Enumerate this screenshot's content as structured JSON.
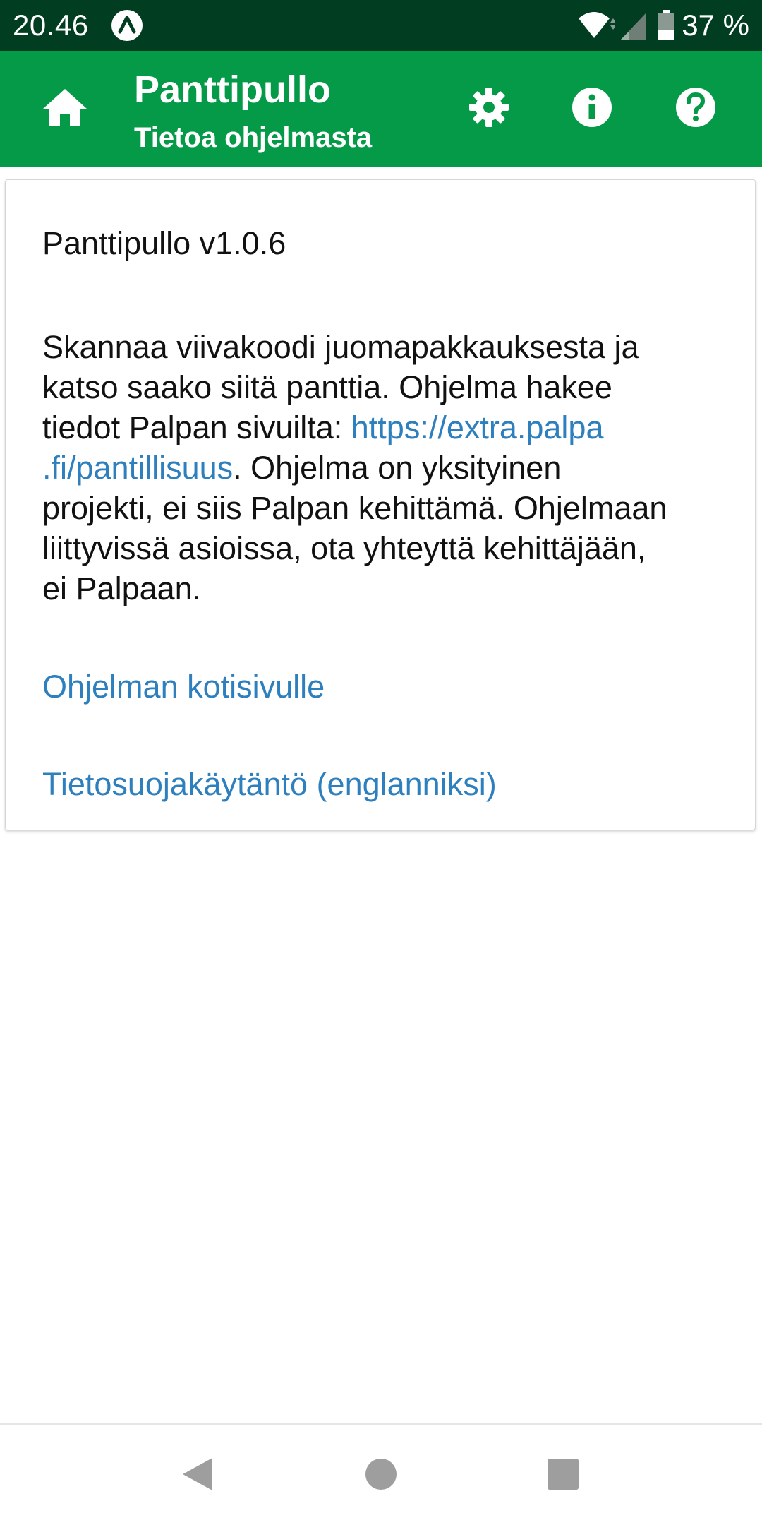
{
  "status_bar": {
    "time": "20.46",
    "battery": "37 %",
    "icons": [
      "app-notification-icon",
      "wifi-icon",
      "cell-signal-icon",
      "battery-icon"
    ]
  },
  "app_bar": {
    "title": "Panttipullo",
    "subtitle": "Tietoa ohjelmasta",
    "background_color": "#049a47",
    "icons": [
      "home-icon",
      "settings-icon",
      "info-icon",
      "help-icon"
    ]
  },
  "about": {
    "version": "Panttipullo v1.0.6",
    "description": {
      "line1": "Skannaa viivakoodi juomapakkauksesta ja",
      "line2": "katso saako siitä panttia. Ohjelma hakee",
      "line3_text": "tiedot Palpan sivuilta: ",
      "line3_link": "https://extra.palpa",
      "line4_link": ".fi/pantillisuus",
      "line4_text": ". Ohjelma on yksityinen",
      "line5": "projekti, ei siis Palpan kehittämä. Ohjelmaan",
      "line6": "liittyvissä asioissa, ota yhteyttä kehittäjään,",
      "line7": "ei Palpaan."
    },
    "homepage_link": "Ohjelman kotisivulle",
    "privacy_link": "Tietosuojakäytäntö (englanniksi)",
    "link_color": "#2d7fbd"
  },
  "nav_bar": {
    "icons": [
      "back-icon",
      "home-circle-icon",
      "recents-icon"
    ]
  }
}
